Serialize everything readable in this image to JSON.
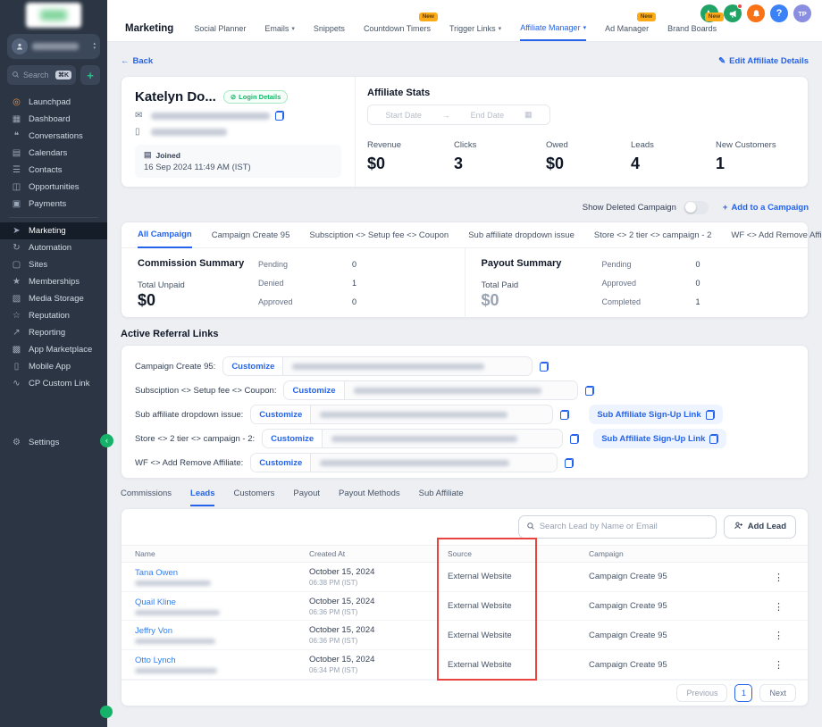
{
  "colors": {
    "accent_blue": "#2563eb",
    "sidebar_bg": "#2b3543",
    "success_green": "#17b26a",
    "badge_amber": "#fbab17",
    "annotation_red": "#e8443f",
    "bell_orange": "#f97316",
    "phone_green": "#22a366",
    "avatar_purple": "#8a8ee0"
  },
  "icons": {
    "back_arrow": "←",
    "range_arrow": "→",
    "caret_down": "▾",
    "kebab": "⋮",
    "plus": "+",
    "help": "?",
    "pencil": "✎",
    "mail": "✉",
    "mobile": "▯",
    "calendar": "▤",
    "calendar_small": "▦",
    "login": "⊘",
    "chevron_left": "‹",
    "chevron_up": "▴",
    "settings_gear": "⚙"
  },
  "sidebar": {
    "search_placeholder": "Search",
    "shortcut": "⌘K",
    "items": [
      {
        "name": "launchpad",
        "glyph": "◎",
        "label": "Launchpad"
      },
      {
        "name": "dashboard",
        "glyph": "▦",
        "label": "Dashboard"
      },
      {
        "name": "conversations",
        "glyph": "❝",
        "label": "Conversations"
      },
      {
        "name": "calendars",
        "glyph": "▤",
        "label": "Calendars"
      },
      {
        "name": "contacts",
        "glyph": "☰",
        "label": "Contacts"
      },
      {
        "name": "opportunities",
        "glyph": "◫",
        "label": "Opportunities"
      },
      {
        "name": "payments",
        "glyph": "▣",
        "label": "Payments"
      },
      {
        "name": "marketing",
        "glyph": "➤",
        "label": "Marketing"
      },
      {
        "name": "automation",
        "glyph": "↻",
        "label": "Automation"
      },
      {
        "name": "sites",
        "glyph": "▢",
        "label": "Sites"
      },
      {
        "name": "memberships",
        "glyph": "★",
        "label": "Memberships"
      },
      {
        "name": "media-storage",
        "glyph": "▧",
        "label": "Media Storage"
      },
      {
        "name": "reputation",
        "glyph": "☆",
        "label": "Reputation"
      },
      {
        "name": "reporting",
        "glyph": "↗",
        "label": "Reporting"
      },
      {
        "name": "app-marketplace",
        "glyph": "▩",
        "label": "App Marketplace"
      },
      {
        "name": "mobile-app",
        "glyph": "▯",
        "label": "Mobile App"
      },
      {
        "name": "cp-custom-link",
        "glyph": "∿",
        "label": "CP Custom Link"
      }
    ],
    "settings_label": "Settings"
  },
  "topnav": {
    "title": "Marketing",
    "items": [
      {
        "label": "Social Planner"
      },
      {
        "label": "Emails"
      },
      {
        "label": "Snippets"
      },
      {
        "label": "Countdown Timers",
        "badge": "New"
      },
      {
        "label": "Trigger Links"
      },
      {
        "label": "Affiliate Manager"
      },
      {
        "label": "Ad Manager",
        "badge": "New"
      },
      {
        "label": "Brand Boards",
        "badge": "New"
      }
    ],
    "avatar_initials": "TP"
  },
  "header": {
    "back_label": "Back",
    "edit_label": "Edit Affiliate Details",
    "name": "Katelyn Do...",
    "login_details_label": "Login Details",
    "joined_label": "Joined",
    "joined_value": "16 Sep 2024 11:49 AM (IST)"
  },
  "stats": {
    "title": "Affiliate Stats",
    "start_date_placeholder": "Start Date",
    "end_date_placeholder": "End Date",
    "items": [
      {
        "label": "Revenue",
        "value": "$0"
      },
      {
        "label": "Clicks",
        "value": "3"
      },
      {
        "label": "Owed",
        "value": "$0"
      },
      {
        "label": "Leads",
        "value": "4"
      },
      {
        "label": "New Customers",
        "value": "1"
      }
    ]
  },
  "campaign": {
    "show_deleted_label": "Show Deleted Campaign",
    "add_to_campaign_label": "Add to a Campaign",
    "tabs": [
      "All Campaign",
      "Campaign Create 95",
      "Subsciption <> Setup fee <> Coupon",
      "Sub affiliate dropdown issue",
      "Store <> 2 tier <> campaign - 2",
      "WF <> Add Remove Affiliate"
    ],
    "commission": {
      "title": "Commission Summary",
      "total_label": "Total Unpaid",
      "total_value": "$0",
      "rows": [
        {
          "label": "Pending",
          "value": "0"
        },
        {
          "label": "Denied",
          "value": "1"
        },
        {
          "label": "Approved",
          "value": "0"
        }
      ]
    },
    "payout": {
      "title": "Payout Summary",
      "total_label": "Total Paid",
      "total_value": "$0",
      "rows": [
        {
          "label": "Pending",
          "value": "0"
        },
        {
          "label": "Approved",
          "value": "0"
        },
        {
          "label": "Completed",
          "value": "1"
        }
      ]
    }
  },
  "referral": {
    "title": "Active Referral Links",
    "customize_label": "Customize",
    "signup_label": "Sub Affiliate Sign-Up Link",
    "rows": [
      {
        "label": "Campaign Create 95:"
      },
      {
        "label": "Subsciption <> Setup fee <> Coupon:"
      },
      {
        "label": "Sub affiliate dropdown issue:"
      },
      {
        "label": "Store <> 2 tier <> campaign - 2:"
      },
      {
        "label": "WF <> Add Remove Affiliate:"
      }
    ]
  },
  "leads": {
    "tabs": [
      "Commissions",
      "Leads",
      "Customers",
      "Payout",
      "Payout Methods",
      "Sub Affiliate"
    ],
    "search_placeholder": "Search Lead by Name or Email",
    "add_lead_label": "Add Lead",
    "columns": [
      "Name",
      "Created At",
      "Source",
      "Campaign"
    ],
    "rows": [
      {
        "name": "Tana Owen",
        "date": "October 15, 2024",
        "time": "06:38 PM (IST)",
        "source": "External Website",
        "campaign": "Campaign Create 95"
      },
      {
        "name": "Quail Kline",
        "date": "October 15, 2024",
        "time": "06:36 PM (IST)",
        "source": "External Website",
        "campaign": "Campaign Create 95"
      },
      {
        "name": "Jeffry Von",
        "date": "October 15, 2024",
        "time": "06:36 PM (IST)",
        "source": "External Website",
        "campaign": "Campaign Create 95"
      },
      {
        "name": "Otto Lynch",
        "date": "October 15, 2024",
        "time": "06:34 PM (IST)",
        "source": "External Website",
        "campaign": "Campaign Create 95"
      }
    ],
    "pagination": {
      "previous": "Previous",
      "page": "1",
      "next": "Next"
    }
  }
}
